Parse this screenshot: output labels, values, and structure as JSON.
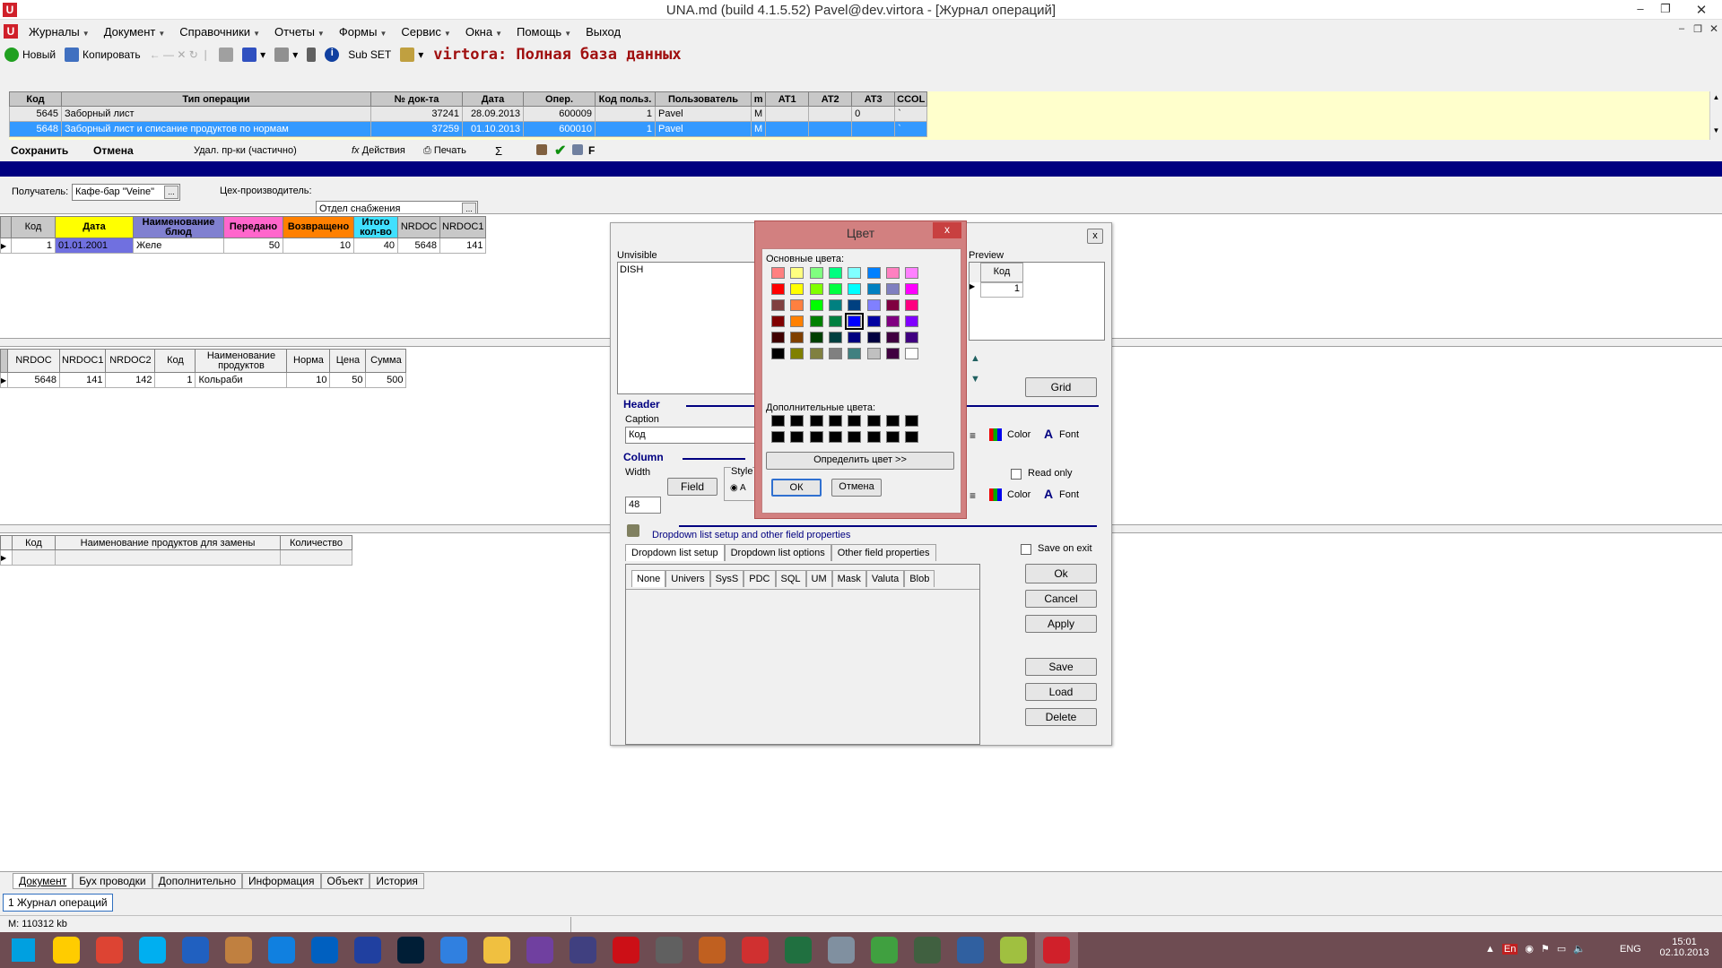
{
  "window": {
    "title": "UNA.md (build 4.1.5.52) Pavel@dev.virtora - [Журнал операций]"
  },
  "menu": [
    "Журналы",
    "Документ",
    "Справочники",
    "Отчеты",
    "Формы",
    "Сервис",
    "Окна",
    "Помощь",
    "Выход"
  ],
  "menu_has_caret": [
    true,
    true,
    true,
    true,
    true,
    true,
    true,
    true,
    false
  ],
  "toolbar": {
    "new": "Новый",
    "copy": "Копировать",
    "subset": "Sub SET",
    "db_title": "virtora: Полная база данных"
  },
  "journal": {
    "headers": [
      "Код",
      "Тип операции",
      "№ док-та",
      "Дата",
      "Опер.",
      "Код польз.",
      "Пользователь",
      "m",
      "AT1",
      "AT2",
      "AT3",
      "CCOL"
    ],
    "rows": [
      [
        "5645",
        "Заборный лист",
        "37241",
        "28.09.2013",
        "600009",
        "1",
        "Pavel",
        "M",
        "",
        "",
        "0",
        "`"
      ],
      [
        "5648",
        "Заборный лист и списание продуктов по нормам",
        "37259",
        "01.10.2013",
        "600010",
        "1",
        "Pavel",
        "M",
        "",
        "",
        "",
        "`"
      ]
    ],
    "selected_row": 1
  },
  "actions": {
    "save": "Сохранить",
    "cancel": "Отмена",
    "delete_partial": "Удал. пр-ки  (частично)",
    "actions": "Действия",
    "print": "Печать",
    "sigma": "Σ",
    "f": "F"
  },
  "doc": {
    "recipient_label": "Получатель:",
    "recipient_value": "Кафе-бар \"Veine\"",
    "workshop_label": "Цех-производитель:",
    "workshop_value": "Отдел снабжения",
    "ellipsis": "..."
  },
  "grid1": {
    "headers": [
      "Код",
      "Дата",
      "Наименование блюд",
      "Передано",
      "Возвращено",
      "Итого кол-во",
      "NRDOC",
      "NRDOC1"
    ],
    "rows": [
      [
        "1",
        "01.01.2001",
        "Желе",
        "50",
        "10",
        "40",
        "5648",
        "141"
      ]
    ]
  },
  "grid2": {
    "headers": [
      "NRDOC",
      "NRDOC1",
      "NRDOC2",
      "Код",
      "Наименование продуктов",
      "Норма",
      "Цена",
      "Сумма"
    ],
    "rows": [
      [
        "5648",
        "141",
        "142",
        "1",
        "Кольраби",
        "10",
        "50",
        "500"
      ]
    ]
  },
  "grid3": {
    "headers": [
      "Код",
      "Наименование продуктов для замены",
      "Количество"
    ]
  },
  "settings": {
    "unvisible_label": "Unvisible",
    "unvisible_items": [
      "DISH"
    ],
    "preview_label": "Preview",
    "preview_header": "Код",
    "preview_value": "1",
    "grid_btn": "Grid",
    "header_section": "Header",
    "caption_label": "Caption",
    "caption_value": "Код",
    "column_section": "Column",
    "width_label": "Width",
    "width_value": "48",
    "field_btn": "Field",
    "style_label": "Style",
    "style_opt": "A",
    "color_label": "Color",
    "font_label": "Font",
    "read_only": "Read only",
    "dropdown_link": "Dropdown list setup and other field properties",
    "tabs": [
      "Dropdown list setup",
      "Dropdown list options",
      "Other field properties"
    ],
    "subtabs": [
      "None",
      "Univers",
      "SysS",
      "PDC",
      "SQL",
      "UM",
      "Mask",
      "Valuta",
      "Blob"
    ],
    "save_on_exit": "Save on exit",
    "buttons": {
      "ok": "Ok",
      "cancel": "Cancel",
      "apply": "Apply",
      "save": "Save",
      "load": "Load",
      "delete": "Delete"
    },
    "close": "x"
  },
  "color_dialog": {
    "title": "Цвет",
    "basic_label": "Основные цвета:",
    "custom_label": "Дополнительные цвета:",
    "define_btn": "Определить цвет >>",
    "ok_btn": "ОК",
    "cancel_btn": "Отмена",
    "close": "x",
    "basic_colors": [
      [
        "#ff8080",
        "#ffff80",
        "#80ff80",
        "#00ff80",
        "#80ffff",
        "#0080ff",
        "#ff80c0",
        "#ff80ff"
      ],
      [
        "#ff0000",
        "#ffff00",
        "#80ff00",
        "#00ff40",
        "#00ffff",
        "#0080c0",
        "#8080c0",
        "#ff00ff"
      ],
      [
        "#804040",
        "#ff8040",
        "#00ff00",
        "#008080",
        "#004080",
        "#8080ff",
        "#800040",
        "#ff0080"
      ],
      [
        "#800000",
        "#ff8000",
        "#008000",
        "#008040",
        "#0000ff",
        "#0000a0",
        "#800080",
        "#8000ff"
      ],
      [
        "#400000",
        "#804000",
        "#004000",
        "#004040",
        "#000080",
        "#000040",
        "#400040",
        "#400080"
      ],
      [
        "#000000",
        "#808000",
        "#808040",
        "#808080",
        "#408080",
        "#c0c0c0",
        "#400040",
        "#ffffff"
      ]
    ],
    "selected": [
      3,
      4
    ],
    "custom_colors": [
      "#000000",
      "#000000",
      "#000000",
      "#000000",
      "#000000",
      "#000000",
      "#000000",
      "#000000",
      "#000000",
      "#000000",
      "#000000",
      "#000000",
      "#000000",
      "#000000",
      "#000000",
      "#000000"
    ]
  },
  "bottom_tabs": [
    "Документ",
    "Бух проводки",
    "Дополнительно",
    "Информация",
    "Объект",
    "История"
  ],
  "window_tab": "1 Журнал операций",
  "status": {
    "memory": "M: 110312 kb"
  },
  "taskbar": {
    "lang": "ENG",
    "time": "15:01",
    "date": "02.10.2013",
    "tray_en": "En"
  },
  "taskbar_icons": [
    "start-icon",
    "archicad-icon",
    "chrome-icon",
    "skype-icon",
    "powershell-icon",
    "explorer-icon",
    "teamviewer-icon",
    "calc-icon",
    "floppy-icon",
    "photoshop-icon",
    "winamp-icon",
    "folder-icon",
    "vs-icon",
    "sphere-icon",
    "opera-icon",
    "disk-icon",
    "globe-icon",
    "acrobat-icon",
    "excel-icon",
    "network-icon",
    "camera-icon",
    "terminal-icon",
    "virtualbox-icon",
    "frog-icon",
    "una-icon"
  ],
  "taskbar_colors": [
    "#00a0e0",
    "#ffcc00",
    "#dd4433",
    "#00aff0",
    "#2060c0",
    "#c08040",
    "#1080e0",
    "#0060c0",
    "#2040a0",
    "#001e36",
    "#3080e0",
    "#f0c040",
    "#7040a0",
    "#404080",
    "#cc0f16",
    "#606060",
    "#c06020",
    "#d03030",
    "#207040",
    "#8090a0",
    "#40a040",
    "#406040",
    "#3060a0",
    "#a0c040",
    "#d0202a"
  ]
}
